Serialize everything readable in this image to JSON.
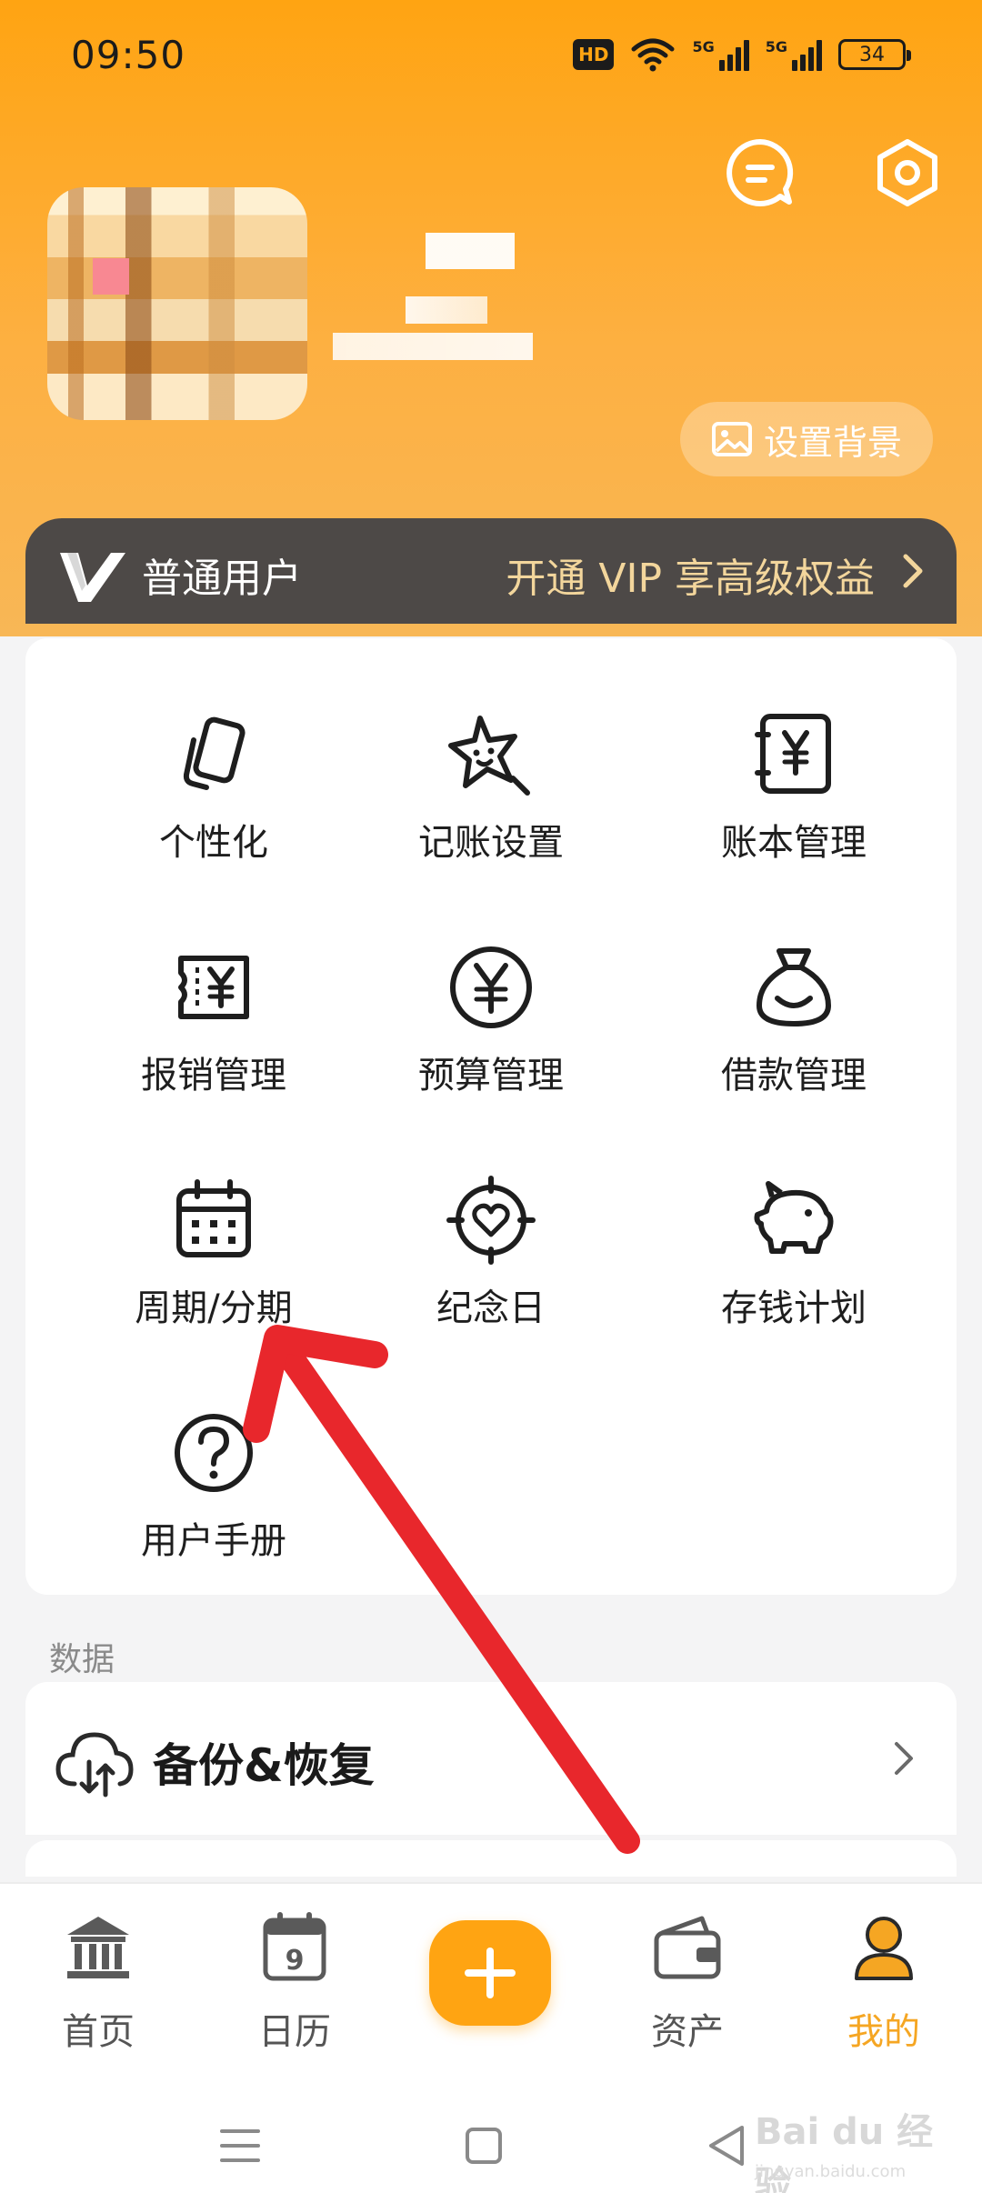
{
  "status_bar": {
    "time": "09:50",
    "hd_badge": "HD",
    "signal_1_label": "5G",
    "signal_2_label": "5G",
    "battery": "34"
  },
  "header": {
    "chat_icon": "chat-bubble-icon",
    "settings_icon": "hexagon-settings-icon",
    "set_background_label": "设置背景",
    "background_color": "#ffa412"
  },
  "vip": {
    "tier_label": "普通用户",
    "promo_label": "开通 VIP 享高级权益"
  },
  "features": [
    {
      "label": "个性化",
      "icon": "personalize-card-icon"
    },
    {
      "label": "记账设置",
      "icon": "star-face-icon"
    },
    {
      "label": "账本管理",
      "icon": "ledger-yen-icon"
    },
    {
      "label": "报销管理",
      "icon": "receipt-yen-icon"
    },
    {
      "label": "预算管理",
      "icon": "yen-circle-icon"
    },
    {
      "label": "借款管理",
      "icon": "money-bag-icon"
    },
    {
      "label": "周期/分期",
      "icon": "calendar-icon"
    },
    {
      "label": "纪念日",
      "icon": "heart-target-icon"
    },
    {
      "label": "存钱计划",
      "icon": "piggy-bank-icon"
    },
    {
      "label": "用户手册",
      "icon": "question-circle-icon"
    }
  ],
  "data_section": {
    "title": "数据",
    "backup_label": "备份&恢复"
  },
  "bottom_nav": {
    "items": [
      {
        "label": "首页",
        "icon": "bank-building-icon"
      },
      {
        "label": "日历",
        "icon": "calendar-day-icon",
        "day": "9"
      },
      {
        "label": "资产",
        "icon": "wallet-icon"
      },
      {
        "label": "我的",
        "icon": "person-icon"
      }
    ],
    "active_index": 3,
    "active_color": "#f5a623"
  },
  "watermark": {
    "brand": "Bai du 经验",
    "url": "jingyan.baidu.com"
  },
  "annotation": {
    "arrow_color": "#e8272c"
  }
}
